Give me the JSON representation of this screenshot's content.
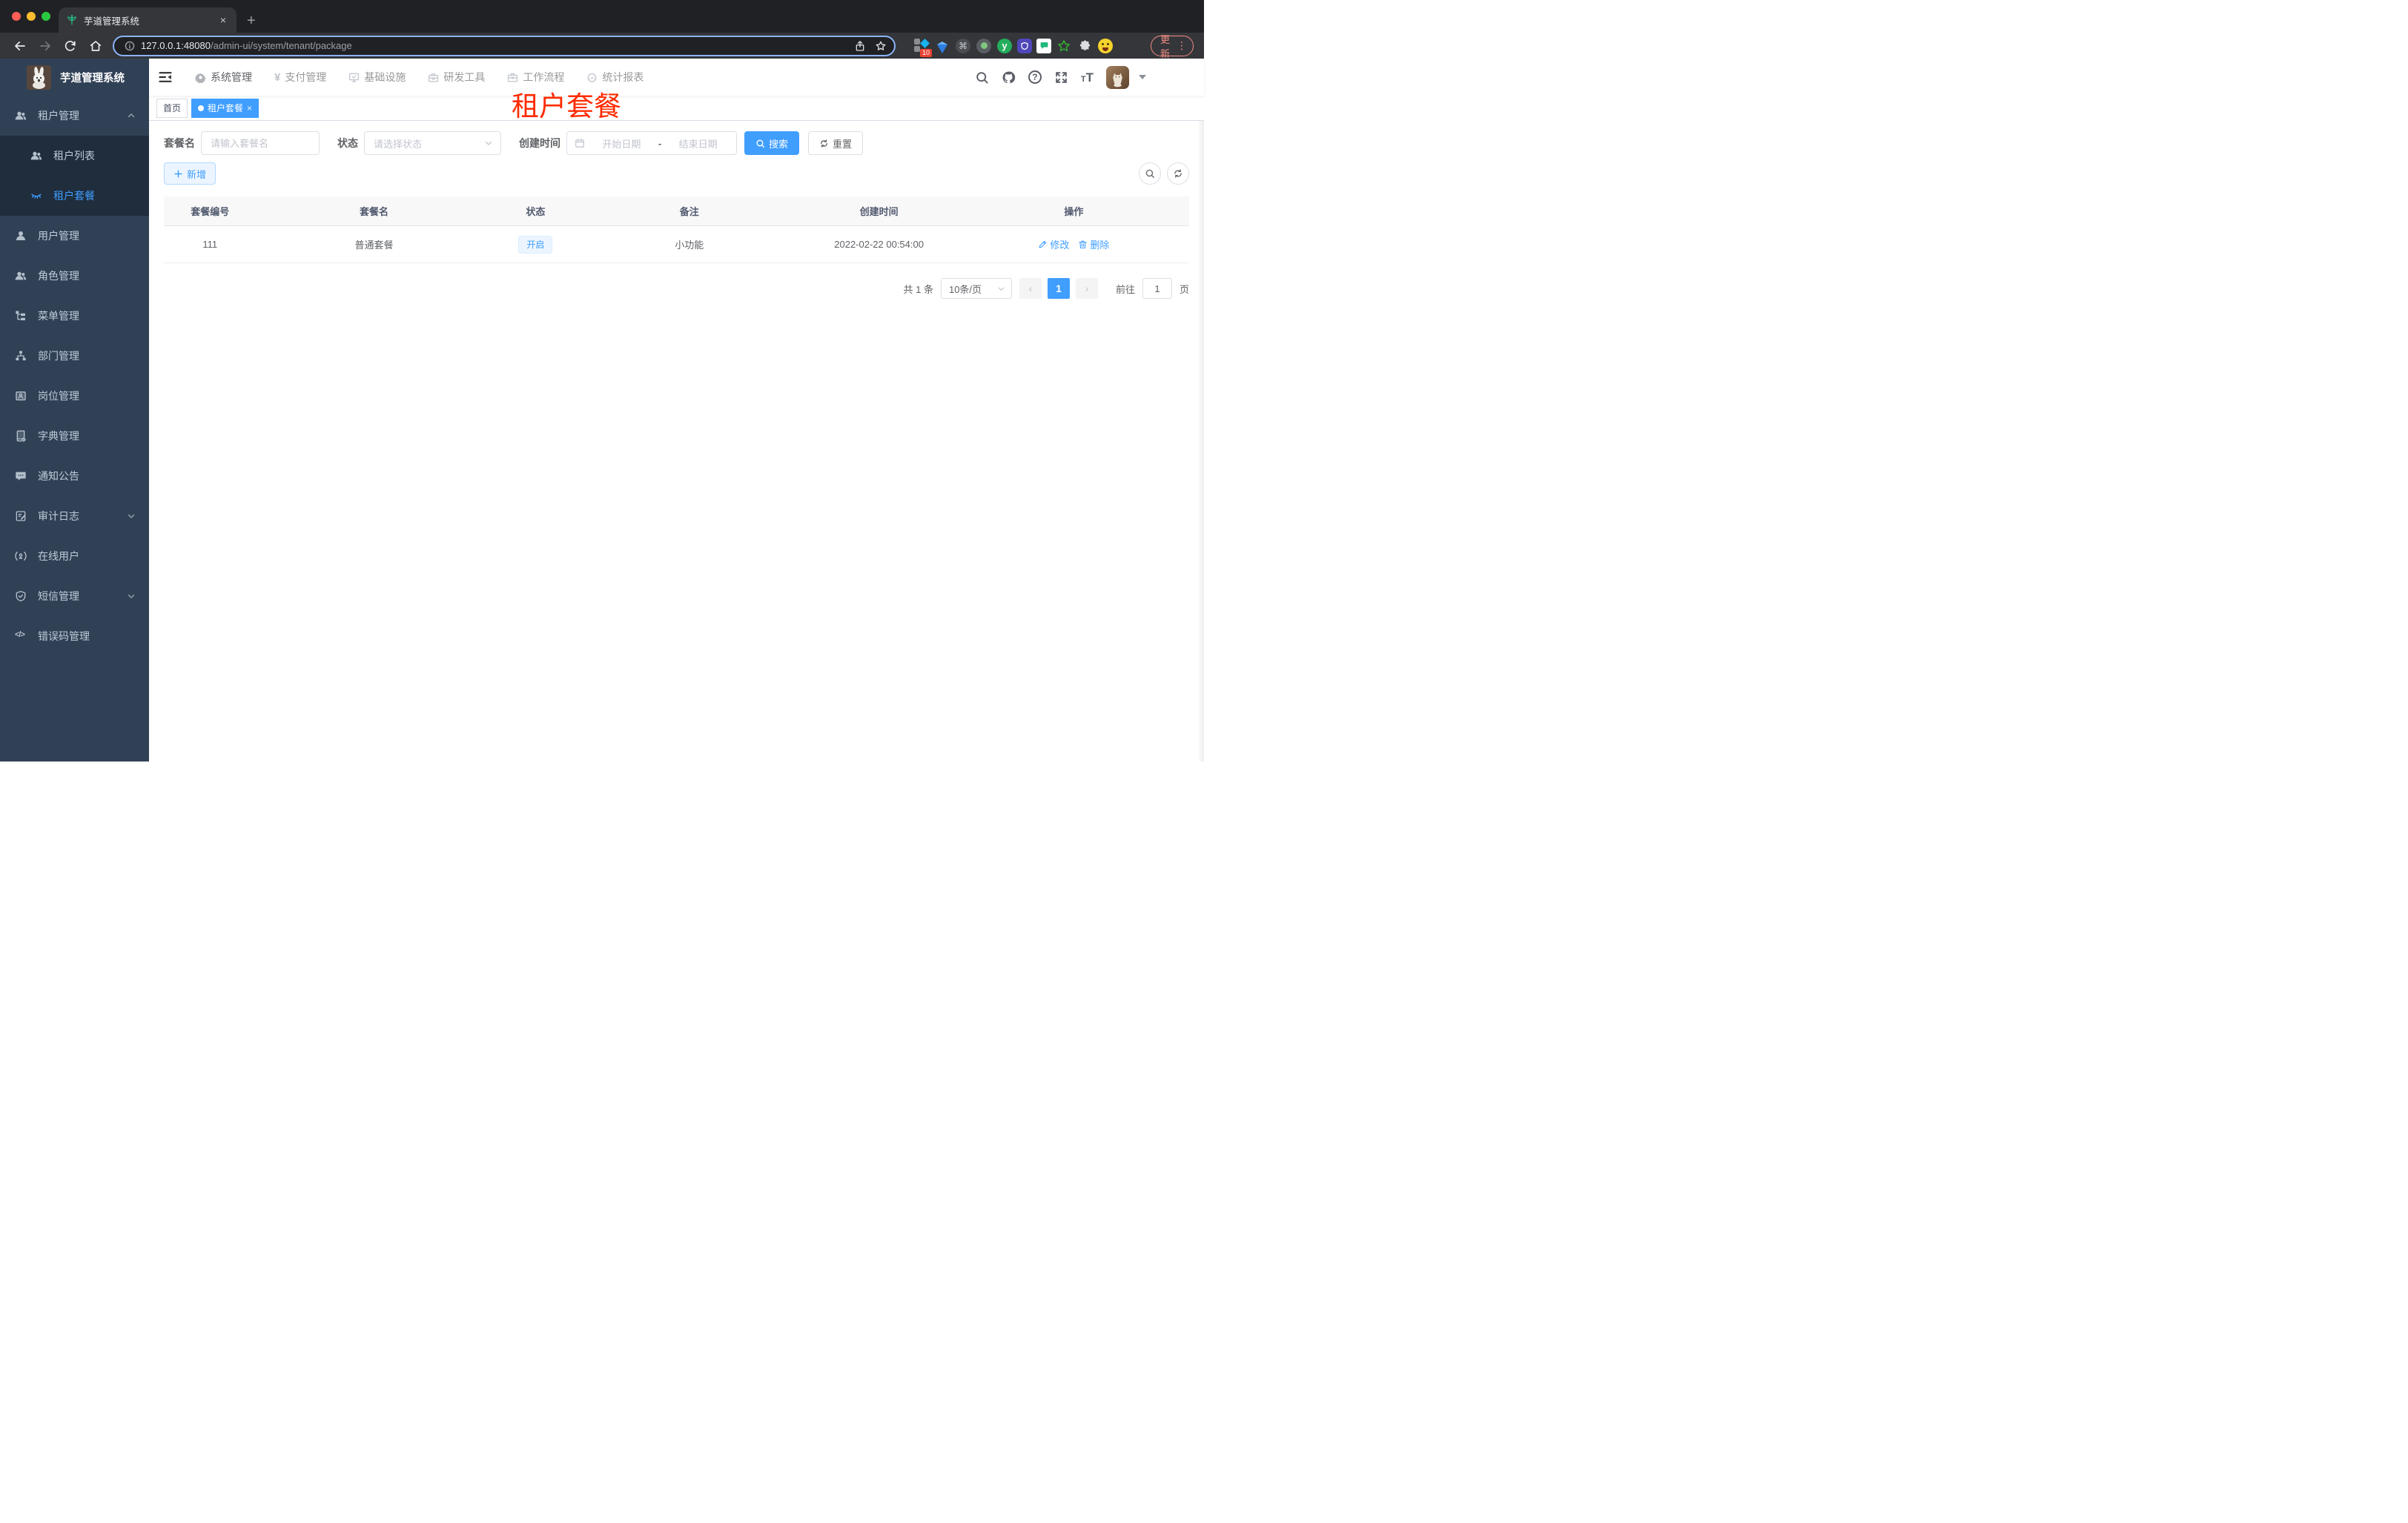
{
  "browser": {
    "tab_title": "芋道管理系统",
    "url_host": "127.0.0.1:48080",
    "url_path": "/admin-ui/system/tenant/package",
    "extension_badge": "10",
    "update_button": "更新"
  },
  "glyphs": {
    "close": "×",
    "new_tab": "+",
    "yen": "¥",
    "question": "?",
    "command": "⌘",
    "dots": "⋮",
    "font_size_large": "T",
    "font_size_small": "T",
    "code": "</>",
    "y_ext": "y",
    "prev": "‹",
    "next": "›"
  },
  "sidebar": {
    "title": "芋道管理系统",
    "items": [
      {
        "label": "租户管理",
        "state": "expanded"
      },
      {
        "label": "租户列表"
      },
      {
        "label": "租户套餐",
        "state": "active"
      },
      {
        "label": "用户管理"
      },
      {
        "label": "角色管理"
      },
      {
        "label": "菜单管理"
      },
      {
        "label": "部门管理"
      },
      {
        "label": "岗位管理"
      },
      {
        "label": "字典管理"
      },
      {
        "label": "通知公告"
      },
      {
        "label": "审计日志",
        "state": "collapsed"
      },
      {
        "label": "在线用户"
      },
      {
        "label": "短信管理",
        "state": "collapsed"
      },
      {
        "label": "错误码管理"
      }
    ]
  },
  "navbar": {
    "menus": [
      {
        "label": "系统管理"
      },
      {
        "label": "支付管理"
      },
      {
        "label": "基础设施"
      },
      {
        "label": "研发工具"
      },
      {
        "label": "工作流程"
      },
      {
        "label": "统计报表"
      }
    ]
  },
  "tags": {
    "home": "首页",
    "active": "租户套餐"
  },
  "page": {
    "watermark": "租户套餐"
  },
  "filter": {
    "name_label": "套餐名",
    "name_placeholder": "请输入套餐名",
    "status_label": "状态",
    "status_placeholder": "请选择状态",
    "date_label": "创建时间",
    "date_start_placeholder": "开始日期",
    "date_separator": "-",
    "date_end_placeholder": "结束日期",
    "search_button": "搜索",
    "reset_button": "重置"
  },
  "toolbar": {
    "add_button": "新增"
  },
  "table": {
    "headers": [
      "套餐编号",
      "套餐名",
      "状态",
      "备注",
      "创建时间",
      "操作"
    ],
    "rows": [
      {
        "id": "111",
        "name": "普通套餐",
        "status": "开启",
        "remark": "小功能",
        "created": "2022-02-22 00:54:00",
        "edit": "修改",
        "delete": "删除"
      }
    ]
  },
  "pagination": {
    "total": "共 1 条",
    "page_size": "10条/页",
    "current_page": "1",
    "goto_label": "前往",
    "goto_value": "1",
    "unit_label": "页"
  },
  "colors": {
    "accent": "#409eff",
    "watermark_red": "#ff2b00",
    "sidebar_bg": "#304156",
    "sidebar_submenu_bg": "#1f2d3d",
    "tag_active_bg": "#409eff",
    "status_tag_bg": "#ecf5ff"
  }
}
